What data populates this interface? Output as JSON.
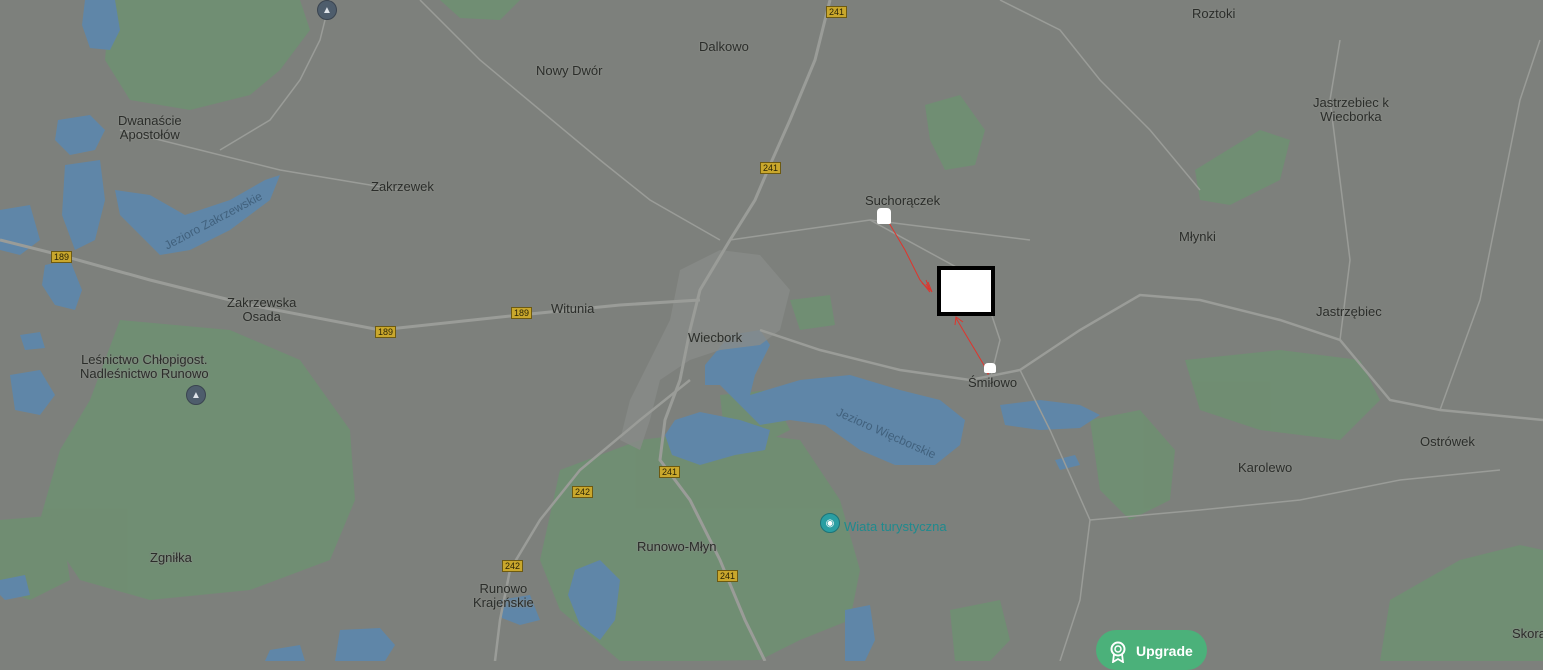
{
  "map": {
    "places": [
      {
        "id": "roztoki",
        "name": "Roztoki"
      },
      {
        "id": "dalkowo",
        "name": "Dalkowo"
      },
      {
        "id": "nowy-dwor",
        "name": "Nowy Dwór"
      },
      {
        "id": "dwanascie-apostolow",
        "name": "Dwanaście\nApostołów"
      },
      {
        "id": "jastrzebiec-k-wiecborka",
        "name": "Jastrzebiec k\nWiecborka"
      },
      {
        "id": "zakrzewek",
        "name": "Zakrzewek"
      },
      {
        "id": "suchoraczek",
        "name": "Suchorączek"
      },
      {
        "id": "mlynki",
        "name": "Młynki"
      },
      {
        "id": "zakrzewska-osada",
        "name": "Zakrzewska\nOsada"
      },
      {
        "id": "witunia",
        "name": "Witunia"
      },
      {
        "id": "wiecbork",
        "name": "Wiecbork"
      },
      {
        "id": "jastrzebiec",
        "name": "Jastrzębiec"
      },
      {
        "id": "lesnictwo",
        "name": "Leśnictwo Chłopigost.\nNadleśnictwo Runowo"
      },
      {
        "id": "smilowo",
        "name": "Śmiłowo"
      },
      {
        "id": "ostrowek",
        "name": "Ostrówek"
      },
      {
        "id": "karolewo",
        "name": "Karolewo"
      },
      {
        "id": "zgnilka",
        "name": "Zgniłka"
      },
      {
        "id": "runowo-mlyn",
        "name": "Runowo-Młyn"
      },
      {
        "id": "runowo-krajenskie",
        "name": "Runowo\nKrajeńskie"
      },
      {
        "id": "skora",
        "name": "Skora"
      }
    ],
    "lakes": [
      {
        "id": "jezioro-zakrzewskie",
        "name": "Jezioro Zakrzewskie"
      },
      {
        "id": "jezioro-wiecborskie",
        "name": "Jezioro Więcborskie"
      }
    ],
    "poi": {
      "wiata": "Wiata turystyczna"
    },
    "road_shields": [
      "241",
      "241",
      "189",
      "189",
      "189",
      "241",
      "242",
      "242",
      "241"
    ],
    "colors": {
      "land": "#7d807c",
      "forest": "#6f8f72",
      "water": "#5f86a8",
      "road": "#9a9c98",
      "flight_track": "#e0342c",
      "upgrade": "#4bb17a"
    }
  },
  "upgrade_button": {
    "label": "Upgrade",
    "icon": "award-icon"
  }
}
